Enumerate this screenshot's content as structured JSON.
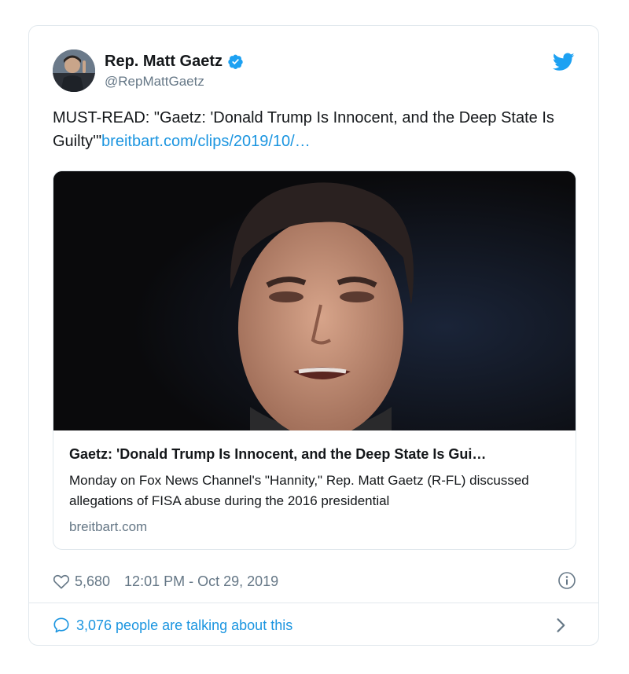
{
  "author": {
    "display_name": "Rep. Matt Gaetz",
    "handle": "@RepMattGaetz",
    "verified": true
  },
  "tweet": {
    "text": "MUST-READ: \"Gaetz: 'Donald Trump Is Innocent, and the Deep State Is Guilty'\"",
    "link_text": "breitbart.com/clips/2019/10/…"
  },
  "card": {
    "title": "Gaetz: 'Donald Trump Is Innocent, and the Deep State Is Gui…",
    "description": "Monday on Fox News Channel's \"Hannity,\" Rep. Matt Gaetz (R-FL) discussed allegations of FISA abuse during the 2016 presidential",
    "domain": "breitbart.com"
  },
  "meta": {
    "likes": "5,680",
    "timestamp": "12:01 PM - Oct 29, 2019"
  },
  "footer": {
    "talking_text": "3,076 people are talking about this"
  },
  "colors": {
    "twitter_blue": "#1b95e0",
    "muted": "#657786",
    "border": "#e1e8ed"
  },
  "icons": {
    "verified": "verified-badge-icon",
    "brand": "twitter-bird-icon",
    "like": "heart-icon",
    "info": "info-icon",
    "reply": "speech-bubble-icon",
    "chevron": "chevron-right-icon"
  }
}
